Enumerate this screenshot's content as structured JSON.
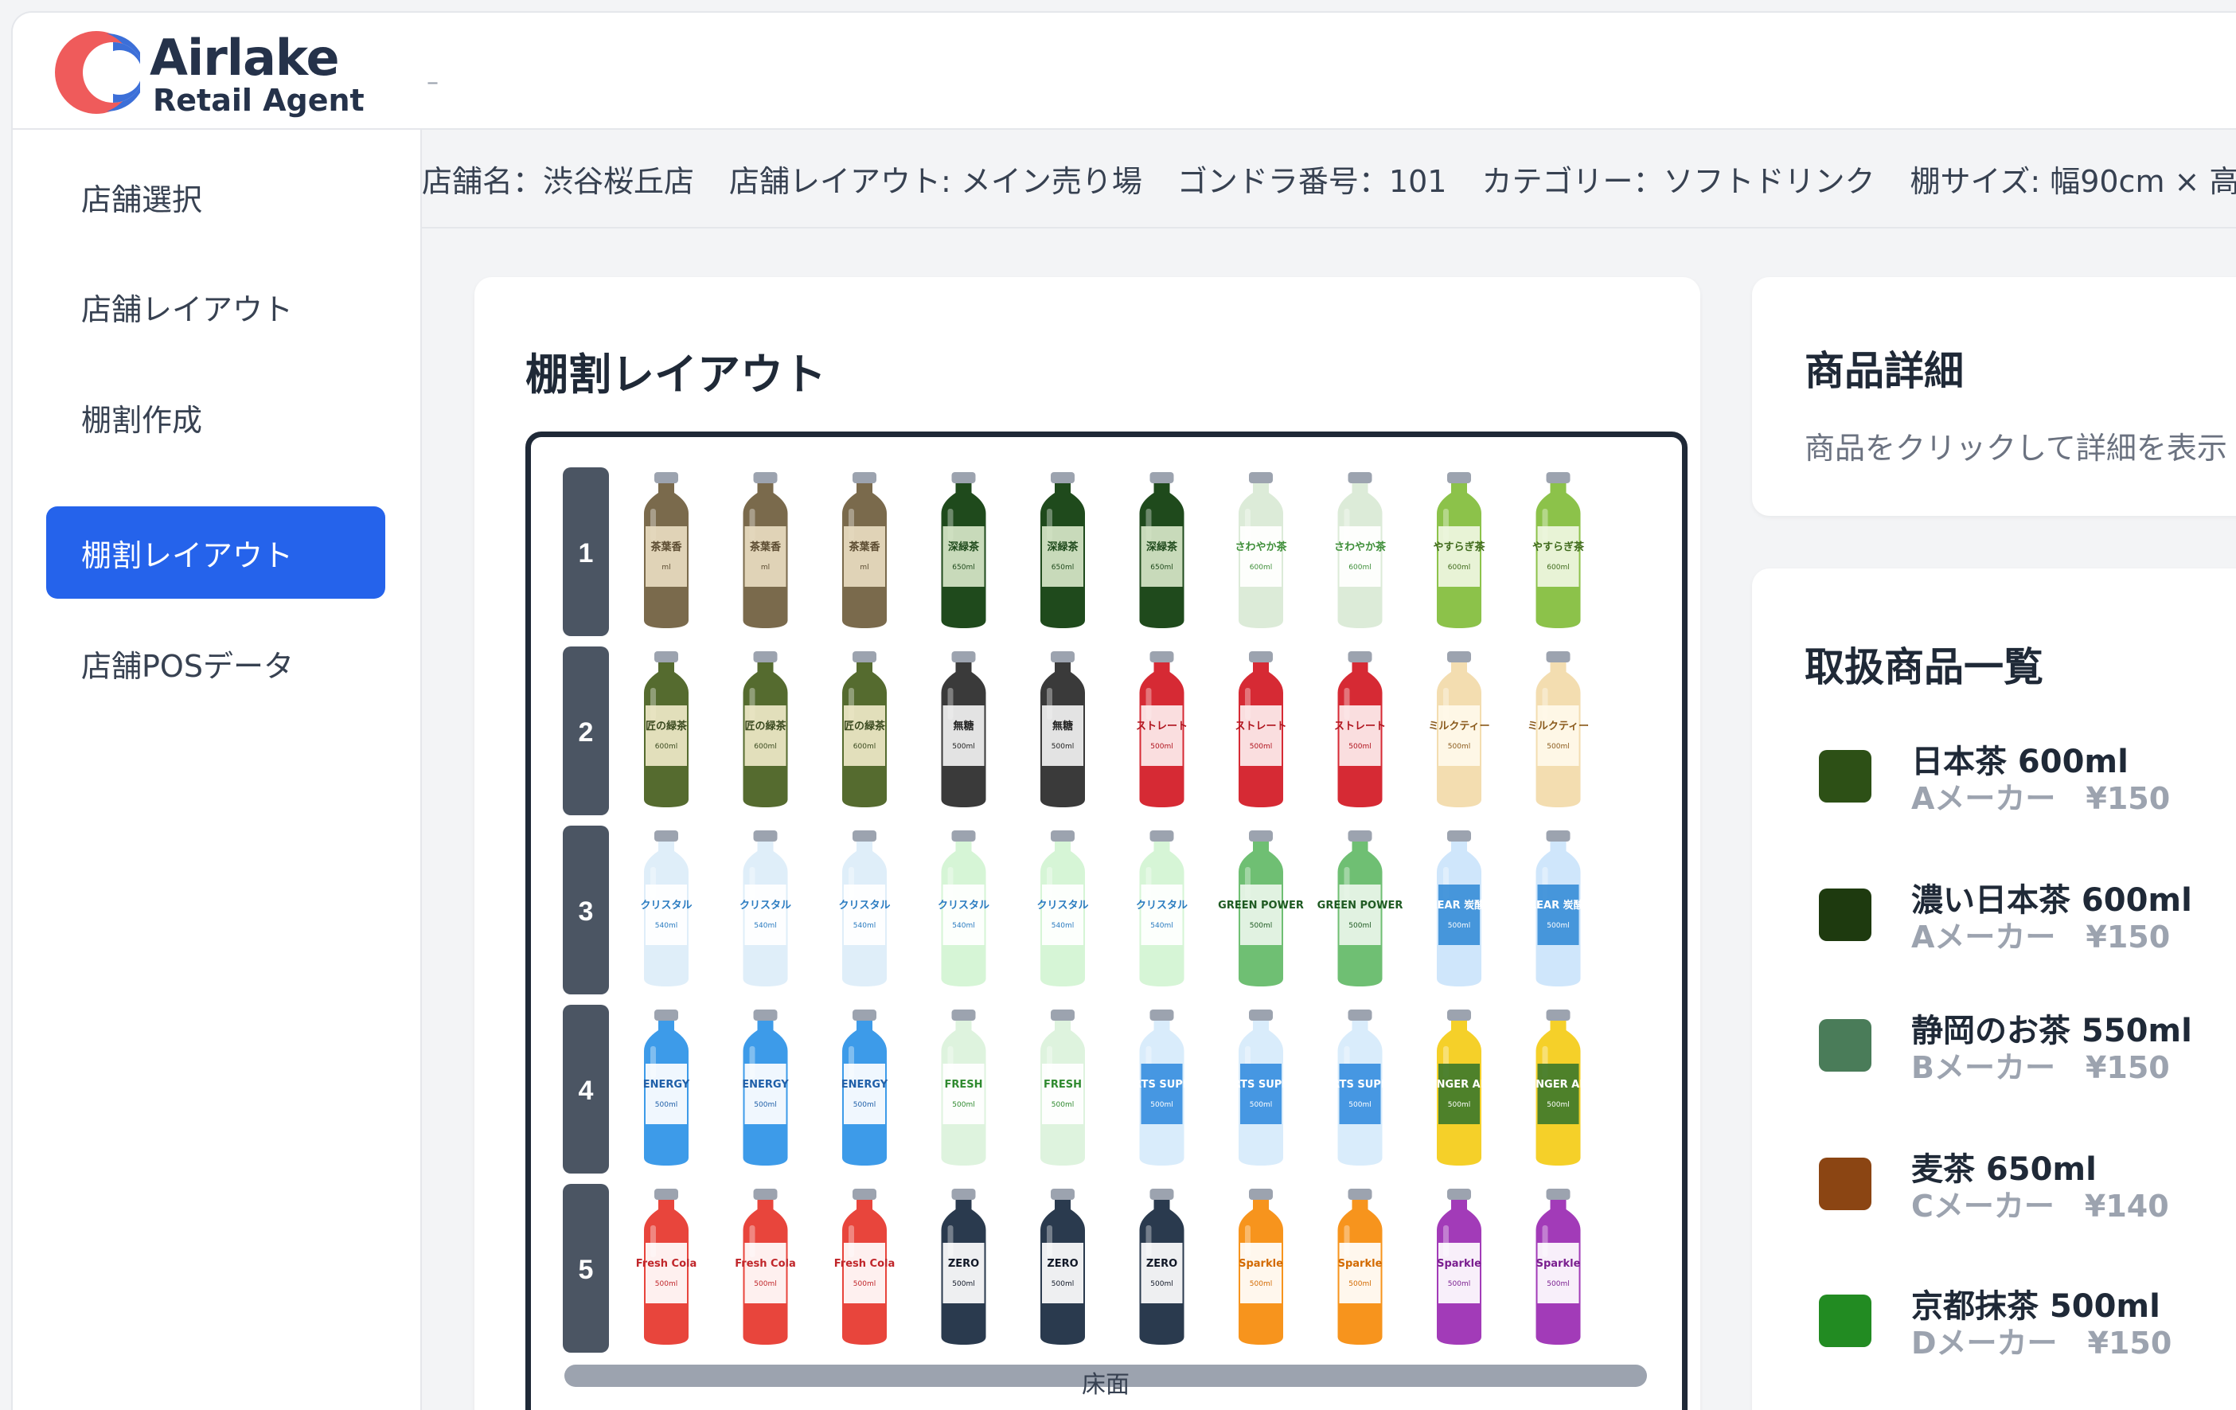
{
  "brand": {
    "name": "Airlake",
    "subtitle": "Retail Agent",
    "header_extra": "–"
  },
  "sidebar": {
    "items": [
      {
        "label": "店舗選択",
        "active": false
      },
      {
        "label": "店舗レイアウト",
        "active": false
      },
      {
        "label": "棚割作成",
        "active": false
      },
      {
        "label": "棚割レイアウト",
        "active": true
      },
      {
        "label": "店舗POSデータ",
        "active": false
      }
    ]
  },
  "info_bar": {
    "store": "店舗名：渋谷桜丘店",
    "layout": "店舗レイアウト: メイン売り場",
    "gondola": "ゴンドラ番号：101",
    "category": "カテゴリー：ソフトドリンク",
    "shelf_size": "棚サイズ: 幅90cm × 高"
  },
  "layout_panel": {
    "title": "棚割レイアウト",
    "floor_label": "床面"
  },
  "shelf_rows": [
    {
      "number": "1",
      "products": [
        {
          "label": "茶葉香",
          "volume": "ml",
          "body": "#7a6a4c",
          "color": "#5a4a30",
          "tag": "#e8dcc0"
        },
        {
          "label": "茶葉香",
          "volume": "ml",
          "body": "#7a6a4c",
          "color": "#5a4a30",
          "tag": "#e8dcc0"
        },
        {
          "label": "茶葉香",
          "volume": "ml",
          "body": "#7a6a4c",
          "color": "#5a4a30",
          "tag": "#e8dcc0"
        },
        {
          "label": "深緑茶",
          "volume": "650ml",
          "body": "#1f4a1c",
          "color": "#1f4a1c",
          "tag": "#d7e6c8"
        },
        {
          "label": "深緑茶",
          "volume": "650ml",
          "body": "#1f4a1c",
          "color": "#1f4a1c",
          "tag": "#d7e6c8"
        },
        {
          "label": "深緑茶",
          "volume": "650ml",
          "body": "#1f4a1c",
          "color": "#1f4a1c",
          "tag": "#d7e6c8"
        },
        {
          "label": "さわやか茶",
          "volume": "600ml",
          "body": "#dcebd8",
          "color": "#3f8f3a",
          "tag": "#ffffff"
        },
        {
          "label": "さわやか茶",
          "volume": "600ml",
          "body": "#dcebd8",
          "color": "#3f8f3a",
          "tag": "#ffffff"
        },
        {
          "label": "やすらぎ茶",
          "volume": "600ml",
          "body": "#8cc24a",
          "color": "#3f6a1c",
          "tag": "#f0f7e2"
        },
        {
          "label": "やすらぎ茶",
          "volume": "600ml",
          "body": "#8cc24a",
          "color": "#3f6a1c",
          "tag": "#f0f7e2"
        }
      ]
    },
    {
      "number": "2",
      "products": [
        {
          "label": "匠の緑茶",
          "volume": "600ml",
          "body": "#556b2f",
          "color": "#3a4a1f",
          "tag": "#efe9c8"
        },
        {
          "label": "匠の緑茶",
          "volume": "600ml",
          "body": "#556b2f",
          "color": "#3a4a1f",
          "tag": "#efe9c8"
        },
        {
          "label": "匠の緑茶",
          "volume": "600ml",
          "body": "#556b2f",
          "color": "#3a4a1f",
          "tag": "#efe9c8"
        },
        {
          "label": "無糖",
          "volume": "500ml",
          "body": "#3a3a3a",
          "color": "#222222",
          "tag": "#f2f2f2"
        },
        {
          "label": "無糖",
          "volume": "500ml",
          "body": "#3a3a3a",
          "color": "#222222",
          "tag": "#f2f2f2"
        },
        {
          "label": "ストレート",
          "volume": "500ml",
          "body": "#d62a34",
          "color": "#b0141e",
          "tag": "#fdeeee"
        },
        {
          "label": "ストレート",
          "volume": "500ml",
          "body": "#d62a34",
          "color": "#b0141e",
          "tag": "#fdeeee"
        },
        {
          "label": "ストレート",
          "volume": "500ml",
          "body": "#d62a34",
          "color": "#b0141e",
          "tag": "#fdeeee"
        },
        {
          "label": "ミルクティー",
          "volume": "500ml",
          "body": "#f3ddb0",
          "color": "#8a5a1c",
          "tag": "#fff8ea"
        },
        {
          "label": "ミルクティー",
          "volume": "500ml",
          "body": "#f3ddb0",
          "color": "#8a5a1c",
          "tag": "#fff8ea"
        }
      ]
    },
    {
      "number": "3",
      "products": [
        {
          "label": "クリスタル",
          "volume": "540ml",
          "body": "#dfeef9",
          "color": "#2a7bc0",
          "tag": "#ffffff"
        },
        {
          "label": "クリスタル",
          "volume": "540ml",
          "body": "#dfeef9",
          "color": "#2a7bc0",
          "tag": "#ffffff"
        },
        {
          "label": "クリスタル",
          "volume": "540ml",
          "body": "#dfeef9",
          "color": "#2a7bc0",
          "tag": "#ffffff"
        },
        {
          "label": "クリスタル",
          "volume": "540ml",
          "body": "#d6f5d6",
          "color": "#2a7bc0",
          "tag": "#ffffff"
        },
        {
          "label": "クリスタル",
          "volume": "540ml",
          "body": "#d6f5d6",
          "color": "#2a7bc0",
          "tag": "#ffffff"
        },
        {
          "label": "クリスタル",
          "volume": "540ml",
          "body": "#d6f5d6",
          "color": "#2a7bc0",
          "tag": "#ffffff"
        },
        {
          "label": "GREEN POWER",
          "volume": "500ml",
          "body": "#6fbf73",
          "color": "#1f5a22",
          "tag": "#eaf6ea"
        },
        {
          "label": "GREEN POWER",
          "volume": "500ml",
          "body": "#6fbf73",
          "color": "#1f5a22",
          "tag": "#eaf6ea"
        },
        {
          "label": "CLEAR 炭酸水",
          "volume": "500ml",
          "body": "#cfe6fb",
          "color": "#ffffff",
          "tag": "#3b8fd8"
        },
        {
          "label": "CLEAR 炭酸水",
          "volume": "500ml",
          "body": "#cfe6fb",
          "color": "#ffffff",
          "tag": "#3b8fd8"
        }
      ]
    },
    {
      "number": "4",
      "products": [
        {
          "label": "ENERGY",
          "volume": "500ml",
          "body": "#3d9be9",
          "color": "#1f5fa8",
          "tag": "#ffffff"
        },
        {
          "label": "ENERGY",
          "volume": "500ml",
          "body": "#3d9be9",
          "color": "#1f5fa8",
          "tag": "#ffffff"
        },
        {
          "label": "ENERGY",
          "volume": "500ml",
          "body": "#3d9be9",
          "color": "#1f5fa8",
          "tag": "#ffffff"
        },
        {
          "label": "FRESH",
          "volume": "500ml",
          "body": "#def3de",
          "color": "#2f8a2f",
          "tag": "#ffffff"
        },
        {
          "label": "FRESH",
          "volume": "500ml",
          "body": "#def3de",
          "color": "#2f8a2f",
          "tag": "#ffffff"
        },
        {
          "label": "SPORTS SUPPORT",
          "volume": "500ml",
          "body": "#d9ecfb",
          "color": "#ffffff",
          "tag": "#3a8fe0"
        },
        {
          "label": "SPORTS SUPPORT",
          "volume": "500ml",
          "body": "#d9ecfb",
          "color": "#ffffff",
          "tag": "#3a8fe0"
        },
        {
          "label": "SPORTS SUPPORT",
          "volume": "500ml",
          "body": "#d9ecfb",
          "color": "#ffffff",
          "tag": "#3a8fe0"
        },
        {
          "label": "GINGER ALE",
          "volume": "500ml",
          "body": "#f5d029",
          "color": "#ffffff",
          "tag": "#3f7a2a"
        },
        {
          "label": "GINGER ALE",
          "volume": "500ml",
          "body": "#f5d029",
          "color": "#ffffff",
          "tag": "#3f7a2a"
        }
      ]
    },
    {
      "number": "5",
      "products": [
        {
          "label": "Fresh Cola",
          "volume": "500ml",
          "body": "#e8453c",
          "color": "#c0262a",
          "tag": "#ffffff"
        },
        {
          "label": "Fresh Cola",
          "volume": "500ml",
          "body": "#e8453c",
          "color": "#c0262a",
          "tag": "#ffffff"
        },
        {
          "label": "Fresh Cola",
          "volume": "500ml",
          "body": "#e8453c",
          "color": "#c0262a",
          "tag": "#ffffff"
        },
        {
          "label": "ZERO",
          "volume": "500ml",
          "body": "#2a3a4e",
          "color": "#111827",
          "tag": "#ffffff"
        },
        {
          "label": "ZERO",
          "volume": "500ml",
          "body": "#2a3a4e",
          "color": "#111827",
          "tag": "#ffffff"
        },
        {
          "label": "ZERO",
          "volume": "500ml",
          "body": "#2a3a4e",
          "color": "#111827",
          "tag": "#ffffff"
        },
        {
          "label": "Sparkle",
          "volume": "500ml",
          "body": "#f7941d",
          "color": "#d36a00",
          "tag": "#ffffff"
        },
        {
          "label": "Sparkle",
          "volume": "500ml",
          "body": "#f7941d",
          "color": "#d36a00",
          "tag": "#ffffff"
        },
        {
          "label": "Sparkle",
          "volume": "500ml",
          "body": "#a23bb8",
          "color": "#7a1f8f",
          "tag": "#ffffff"
        },
        {
          "label": "Sparkle",
          "volume": "500ml",
          "body": "#a23bb8",
          "color": "#7a1f8f",
          "tag": "#ffffff"
        }
      ]
    }
  ],
  "detail_panel": {
    "title": "商品詳細",
    "hint": "商品をクリックして詳細を表示"
  },
  "product_list": {
    "title": "取扱商品一覧",
    "items": [
      {
        "name": "日本茶 600ml",
        "meta": "Aメーカー　¥150",
        "color": "#2d5016"
      },
      {
        "name": "濃い日本茶 600ml",
        "meta": "Aメーカー　¥150",
        "color": "#1e3a0f"
      },
      {
        "name": "静岡のお茶 550ml",
        "meta": "Bメーカー　¥150",
        "color": "#4a7c59"
      },
      {
        "name": "麦茶 650ml",
        "meta": "Cメーカー　¥140",
        "color": "#8b4513"
      },
      {
        "name": "京都抹茶 500ml",
        "meta": "Dメーカー　¥150",
        "color": "#228b22"
      }
    ]
  }
}
